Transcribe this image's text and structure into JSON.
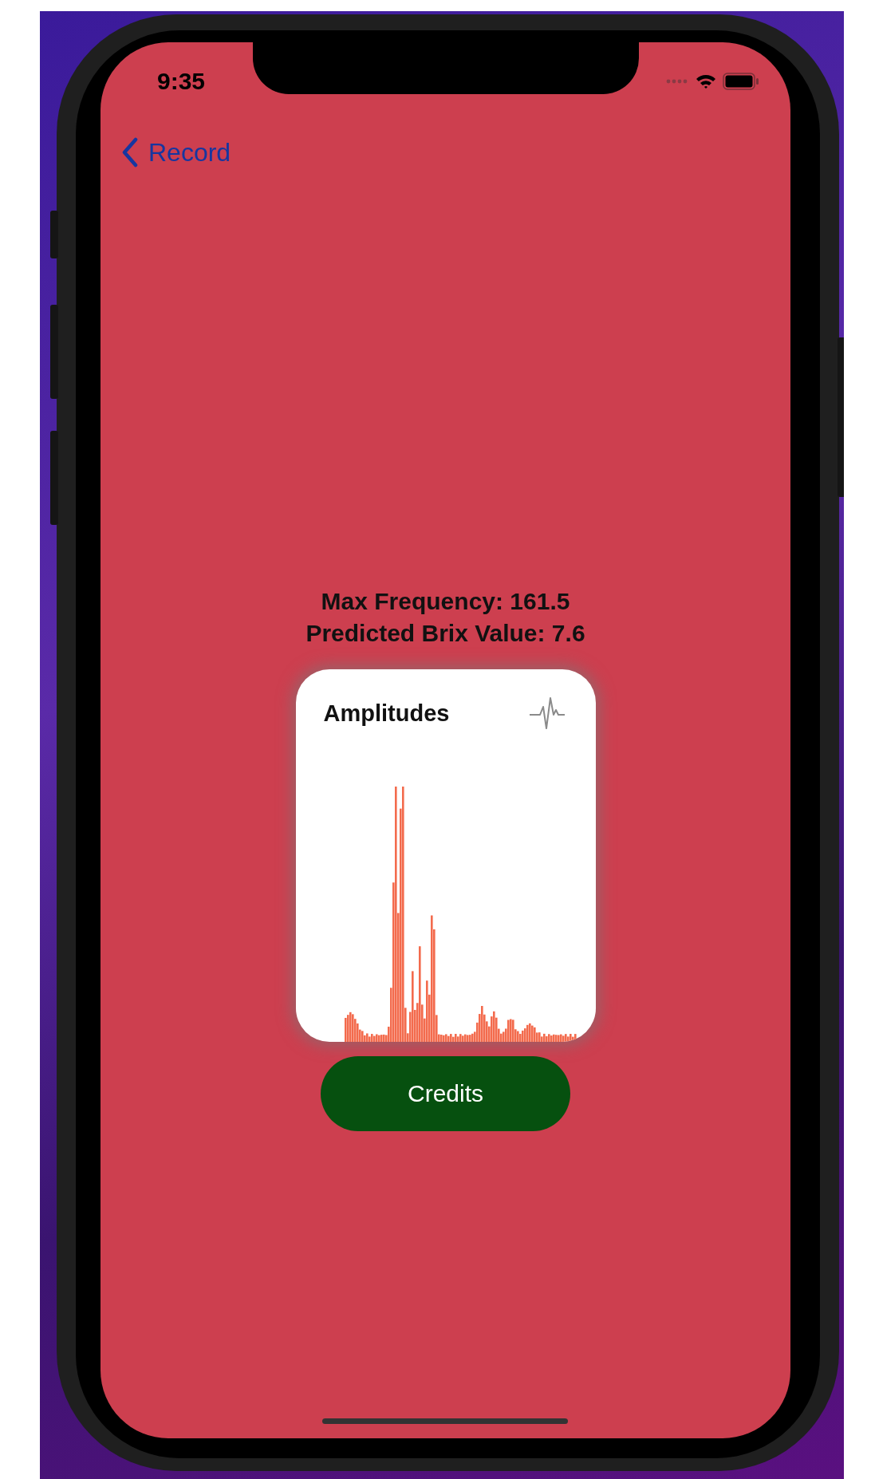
{
  "status_bar": {
    "time": "9:35"
  },
  "nav": {
    "back_label": "Record"
  },
  "results": [
    "Max Frequency: 161.5",
    "Predicted Brix Value: 7.6"
  ],
  "card": {
    "title": "Amplitudes"
  },
  "button": {
    "label": "Credits"
  }
}
